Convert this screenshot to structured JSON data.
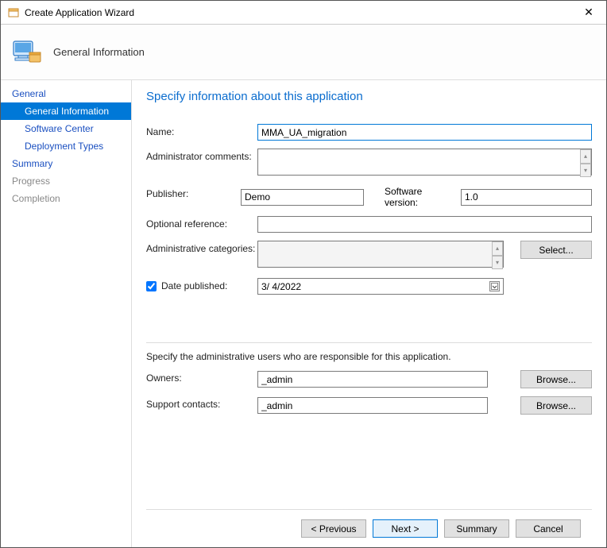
{
  "window": {
    "title": "Create Application Wizard",
    "close_label": "✕"
  },
  "header": {
    "title": "General Information"
  },
  "sidebar": {
    "items": [
      {
        "label": "General",
        "type": "parent"
      },
      {
        "label": "General Information",
        "type": "child",
        "selected": true
      },
      {
        "label": "Software Center",
        "type": "child"
      },
      {
        "label": "Deployment Types",
        "type": "child"
      },
      {
        "label": "Summary",
        "type": "parent"
      },
      {
        "label": "Progress",
        "type": "disabled"
      },
      {
        "label": "Completion",
        "type": "disabled"
      }
    ]
  },
  "main": {
    "heading": "Specify information about this application",
    "labels": {
      "name": "Name:",
      "admin_comments": "Administrator comments:",
      "publisher": "Publisher:",
      "software_version": "Software version:",
      "optional_reference": "Optional reference:",
      "admin_categories": "Administrative categories:",
      "date_published": "Date published:",
      "subhead": "Specify the administrative users who are responsible for this application.",
      "owners": "Owners:",
      "support_contacts": "Support contacts:"
    },
    "values": {
      "name": "MMA_UA_migration",
      "admin_comments": "",
      "publisher": "Demo",
      "software_version": "1.0",
      "optional_reference": "",
      "admin_categories": "",
      "date_published_checked": true,
      "date_published": "3/  4/2022",
      "owners": "_admin",
      "support_contacts": "_admin"
    },
    "buttons": {
      "select": "Select...",
      "browse": "Browse..."
    }
  },
  "footer": {
    "previous": "< Previous",
    "next": "Next >",
    "summary": "Summary",
    "cancel": "Cancel"
  }
}
